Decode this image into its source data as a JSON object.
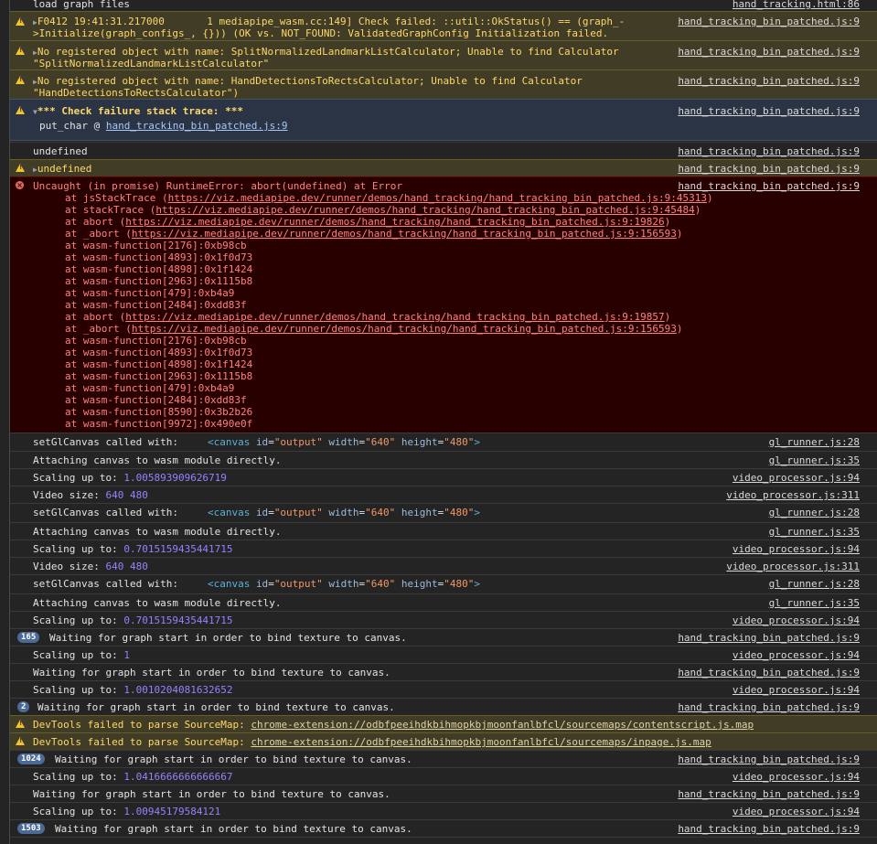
{
  "rows": {
    "load": {
      "text": "load graph files",
      "src": "hand_tracking.html:86"
    },
    "f0412": {
      "line1": "F0412 19:41:31.217000       1 mediapipe_wasm.cc:149] Check failed: ::util::OkStatus() == (graph_-",
      "line2": ">Initialize(graph_configs_, {})) (OK vs. NOT_FOUND: ValidatedGraphConfig Initialization failed.",
      "src": "hand_tracking_bin_patched.js:9"
    },
    "split": {
      "line1": "No registered object with name: SplitNormalizedLandmarkListCalculator; Unable to find Calculator",
      "line2": "\"SplitNormalizedLandmarkListCalculator\"",
      "src": "hand_tracking_bin_patched.js:9"
    },
    "hdtr": {
      "line1": "No registered object with name: HandDetectionsToRectsCalculator; Unable to find Calculator",
      "line2": "\"HandDetectionsToRectsCalculator\")",
      "src": "hand_tracking_bin_patched.js:9"
    },
    "stack": {
      "text": "*** Check failure stack trace: ***",
      "put": "put_char @ ",
      "put_link": "hand_tracking_bin_patched.js:9",
      "src": "hand_tracking_bin_patched.js:9"
    },
    "undef1": {
      "text": "undefined",
      "src": "hand_tracking_bin_patched.js:9"
    },
    "undef2": {
      "text": "undefined",
      "src": "hand_tracking_bin_patched.js:9"
    },
    "uncaught": {
      "text": "Uncaught (in promise) RuntimeError: abort(undefined) at Error",
      "src": "hand_tracking_bin_patched.js:9"
    },
    "gl1": {
      "label": "setGlCanvas called with:",
      "src": "gl_runner.js:28"
    },
    "att1": {
      "text": "Attaching canvas to wasm module directly.",
      "src": "gl_runner.js:35"
    },
    "sc1": {
      "label": "Scaling up to: ",
      "value": "1.005893909626719",
      "src": "video_processor.js:94"
    },
    "vs1": {
      "label": "Video size: ",
      "value": "640 480",
      "src": "video_processor.js:311"
    },
    "gl2": {
      "label": "setGlCanvas called with:",
      "src": "gl_runner.js:28"
    },
    "att2": {
      "text": "Attaching canvas to wasm module directly.",
      "src": "gl_runner.js:35"
    },
    "sc2": {
      "label": "Scaling up to: ",
      "value": "0.7015159435441715",
      "src": "video_processor.js:94"
    },
    "vs2": {
      "label": "Video size: ",
      "value": "640 480",
      "src": "video_processor.js:311"
    },
    "gl3": {
      "label": "setGlCanvas called with:",
      "src": "gl_runner.js:28"
    },
    "att3": {
      "text": "Attaching canvas to wasm module directly.",
      "src": "gl_runner.js:35"
    },
    "sc3": {
      "label": "Scaling up to: ",
      "value": "0.7015159435441715",
      "src": "video_processor.js:94"
    },
    "w1": {
      "count": "165",
      "text": "Waiting for graph start in order to bind texture to canvas.",
      "src": "hand_tracking_bin_patched.js:9"
    },
    "sc4": {
      "label": "Scaling up to: ",
      "value": "1",
      "src": "video_processor.js:94"
    },
    "w2": {
      "text": "Waiting for graph start in order to bind texture to canvas.",
      "src": "hand_tracking_bin_patched.js:9"
    },
    "sc5": {
      "label": "Scaling up to: ",
      "value": "1.0010204081632652",
      "src": "video_processor.js:94"
    },
    "w3": {
      "count": "2",
      "text": "Waiting for graph start in order to bind texture to canvas.",
      "src": "hand_tracking_bin_patched.js:9"
    },
    "dt1": {
      "text": "DevTools failed to parse SourceMap: ",
      "link": "chrome-extension://odbfpeeihdkbihmopkbjmoonfanlbfcl/sourcemaps/contentscript.js.map"
    },
    "dt2": {
      "text": "DevTools failed to parse SourceMap: ",
      "link": "chrome-extension://odbfpeeihdkbihmopkbjmoonfanlbfcl/sourcemaps/inpage.js.map"
    },
    "w4": {
      "count": "1024",
      "text": "Waiting for graph start in order to bind texture to canvas.",
      "src": "hand_tracking_bin_patched.js:9"
    },
    "sc6": {
      "label": "Scaling up to: ",
      "value": "1.0416666666666667",
      "src": "video_processor.js:94"
    },
    "w5": {
      "text": "Waiting for graph start in order to bind texture to canvas.",
      "src": "hand_tracking_bin_patched.js:9"
    },
    "sc7": {
      "label": "Scaling up to: ",
      "value": "1.00945179584121",
      "src": "video_processor.js:94"
    },
    "w6": {
      "count": "1503",
      "text": "Waiting for graph start in order to bind texture to canvas.",
      "src": "hand_tracking_bin_patched.js:9"
    }
  },
  "canvas": {
    "open": "<canvas ",
    "id_attr": "id",
    "id_val": "\"output\"",
    "w_attr": "width",
    "w_val": "\"640\"",
    "h_attr": "height",
    "h_val": "\"480\"",
    "close": ">",
    "eq": "="
  },
  "stack_trace": [
    {
      "pre": "at jsStackTrace (",
      "link": "https://viz.mediapipe.dev/runner/demos/hand_tracking/hand_tracking_bin_patched.js:9:45313",
      "post": ")"
    },
    {
      "pre": "at stackTrace (",
      "link": "https://viz.mediapipe.dev/runner/demos/hand_tracking/hand_tracking_bin_patched.js:9:45484",
      "post": ")"
    },
    {
      "pre": "at abort (",
      "link": "https://viz.mediapipe.dev/runner/demos/hand_tracking/hand_tracking_bin_patched.js:9:19826",
      "post": ")"
    },
    {
      "pre": "at _abort (",
      "link": "https://viz.mediapipe.dev/runner/demos/hand_tracking/hand_tracking_bin_patched.js:9:156593",
      "post": ")"
    },
    {
      "pre": "at wasm-function[2176]:0xb98cb",
      "link": "",
      "post": ""
    },
    {
      "pre": "at wasm-function[4893]:0x1f0d73",
      "link": "",
      "post": ""
    },
    {
      "pre": "at wasm-function[4898]:0x1f1424",
      "link": "",
      "post": ""
    },
    {
      "pre": "at wasm-function[2963]:0x1115b8",
      "link": "",
      "post": ""
    },
    {
      "pre": "at wasm-function[479]:0xb4a9",
      "link": "",
      "post": ""
    },
    {
      "pre": "at wasm-function[2484]:0xdd83f",
      "link": "",
      "post": ""
    },
    {
      "pre": "at abort (",
      "link": "https://viz.mediapipe.dev/runner/demos/hand_tracking/hand_tracking_bin_patched.js:9:19857",
      "post": ")"
    },
    {
      "pre": "at _abort (",
      "link": "https://viz.mediapipe.dev/runner/demos/hand_tracking/hand_tracking_bin_patched.js:9:156593",
      "post": ")"
    },
    {
      "pre": "at wasm-function[2176]:0xb98cb",
      "link": "",
      "post": ""
    },
    {
      "pre": "at wasm-function[4893]:0x1f0d73",
      "link": "",
      "post": ""
    },
    {
      "pre": "at wasm-function[4898]:0x1f1424",
      "link": "",
      "post": ""
    },
    {
      "pre": "at wasm-function[2963]:0x1115b8",
      "link": "",
      "post": ""
    },
    {
      "pre": "at wasm-function[479]:0xb4a9",
      "link": "",
      "post": ""
    },
    {
      "pre": "at wasm-function[2484]:0xdd83f",
      "link": "",
      "post": ""
    },
    {
      "pre": "at wasm-function[8590]:0x3b2b26",
      "link": "",
      "post": ""
    },
    {
      "pre": "at wasm-function[9972]:0x490e0f",
      "link": "",
      "post": ""
    }
  ],
  "colors": {
    "warning_bg": "#413c26",
    "error_bg": "#290000",
    "number": "#9980ff",
    "badge": "#4c6a96"
  },
  "icons": {
    "warning": "warning-triangle-icon",
    "error": "error-circle-icon",
    "expand": "expand-triangle-icon"
  }
}
